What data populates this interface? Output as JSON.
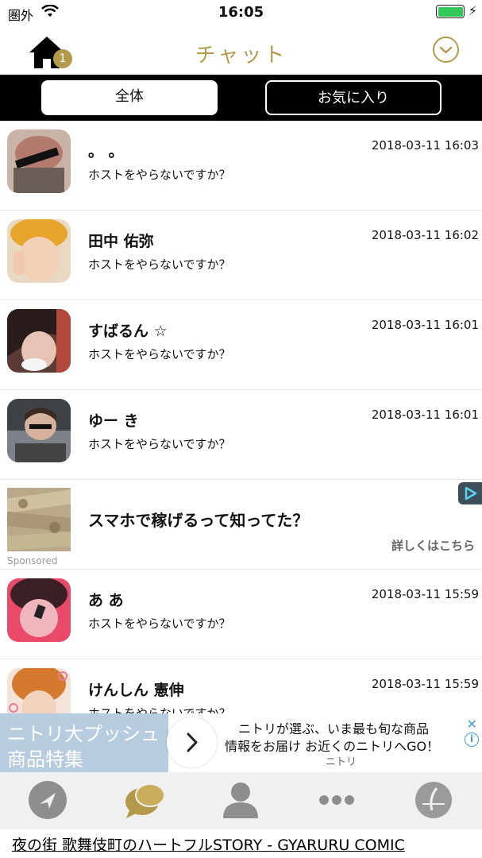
{
  "status": {
    "carrier": "圏外",
    "time": "16:05"
  },
  "header": {
    "badge": "1",
    "title": "チャット"
  },
  "tabs": [
    {
      "label": "全体"
    },
    {
      "label": "お気に入り"
    }
  ],
  "chats": [
    {
      "name": "。 。",
      "time": "2018-03-11 16:03",
      "message": "ホストをやらないですか？"
    },
    {
      "name": "田中 佑弥",
      "time": "2018-03-11 16:02",
      "message": "ホストをやらないですか？"
    },
    {
      "name": "すばるん ☆",
      "time": "2018-03-11 16:01",
      "message": "ホストをやらないですか？"
    },
    {
      "name": "ゆー き",
      "time": "2018-03-11 16:01",
      "message": "ホストをやらないですか？"
    }
  ],
  "sponsored_item": {
    "title": "スマホで稼げるって知ってた？",
    "link": "詳しくはこちら",
    "label": "Sponsored"
  },
  "chats_after": [
    {
      "name": "あ あ",
      "time": "2018-03-11 15:59",
      "message": "ホストをやらないですか？"
    },
    {
      "name": "けんしん 憲伸",
      "time": "2018-03-11 15:59",
      "message": "ホストをやらないですか？"
    }
  ],
  "banner": {
    "left_line1": "ニトリ大プッシュ",
    "left_line2": "商品特集",
    "line1": "ニトリが選ぶ、いま最も旬な商品",
    "line2": "情報をお届け お近くのニトリへGO！",
    "brand": "ニトリ"
  },
  "marquee": "夜の街 歌舞伎町のハートフルSTORY - GYARURU COMIC",
  "colors": {
    "accent": "#b5994a",
    "tab_bg": "#000000",
    "banner_bg": "#b8cce0"
  }
}
